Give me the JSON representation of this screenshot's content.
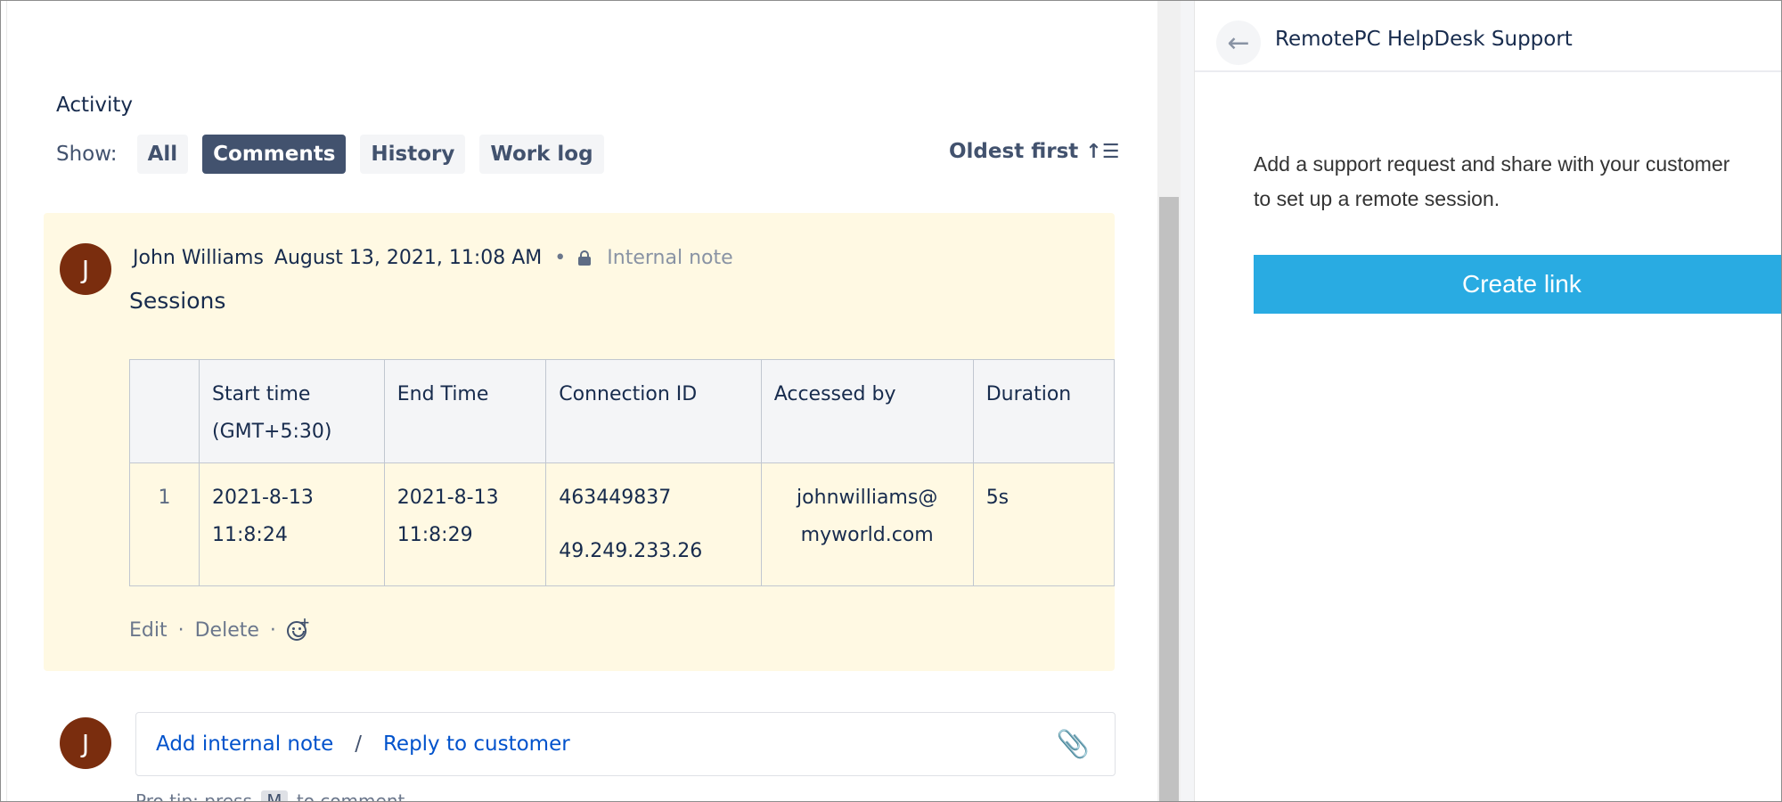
{
  "activity": {
    "title": "Activity",
    "show_label": "Show:",
    "filters": [
      "All",
      "Comments",
      "History",
      "Work log"
    ],
    "active_filter": "Comments",
    "sort_label": "Oldest first"
  },
  "comment": {
    "avatar_initial": "J",
    "author": "John Williams",
    "date": "August 13, 2021, 11:08 AM",
    "visibility": "Internal note",
    "title": "Sessions",
    "table": {
      "headers": [
        "",
        "Start time (GMT+5:30)",
        "End Time",
        "Connection ID",
        "Accessed by",
        "Duration"
      ],
      "header_lines": {
        "start": [
          "Start time",
          "(GMT+5:30)"
        ]
      },
      "rows": [
        {
          "num": "1",
          "start": [
            "2021-8-13",
            "11:8:24"
          ],
          "end": [
            "2021-8-13",
            "11:8:29"
          ],
          "connection": [
            "463449837",
            "49.249.233.26"
          ],
          "accessed_by": [
            "johnwilliams@",
            "myworld.com"
          ],
          "duration": "5s"
        }
      ]
    },
    "actions": {
      "edit": "Edit",
      "delete": "Delete",
      "sep": "·"
    }
  },
  "reply": {
    "avatar_initial": "J",
    "add_internal_note": "Add internal note",
    "slash": "/",
    "reply_to_customer": "Reply to customer",
    "pro_tip_prefix": "Pro tip: press",
    "pro_tip_key": "M",
    "pro_tip_suffix": "to comment"
  },
  "right_panel": {
    "back_icon": "arrow-left-icon",
    "title": "RemotePC HelpDesk Support",
    "description_line1": "Add a support request and share with your customer",
    "description_line2": "to set up a remote session.",
    "create_button": "Create link"
  },
  "colors": {
    "comment_bg": "#fff9e3",
    "active_filter_bg": "#42526e",
    "avatar_bg": "#7a2d0e",
    "link": "#0052cc",
    "create_button_bg": "#29abe2"
  }
}
